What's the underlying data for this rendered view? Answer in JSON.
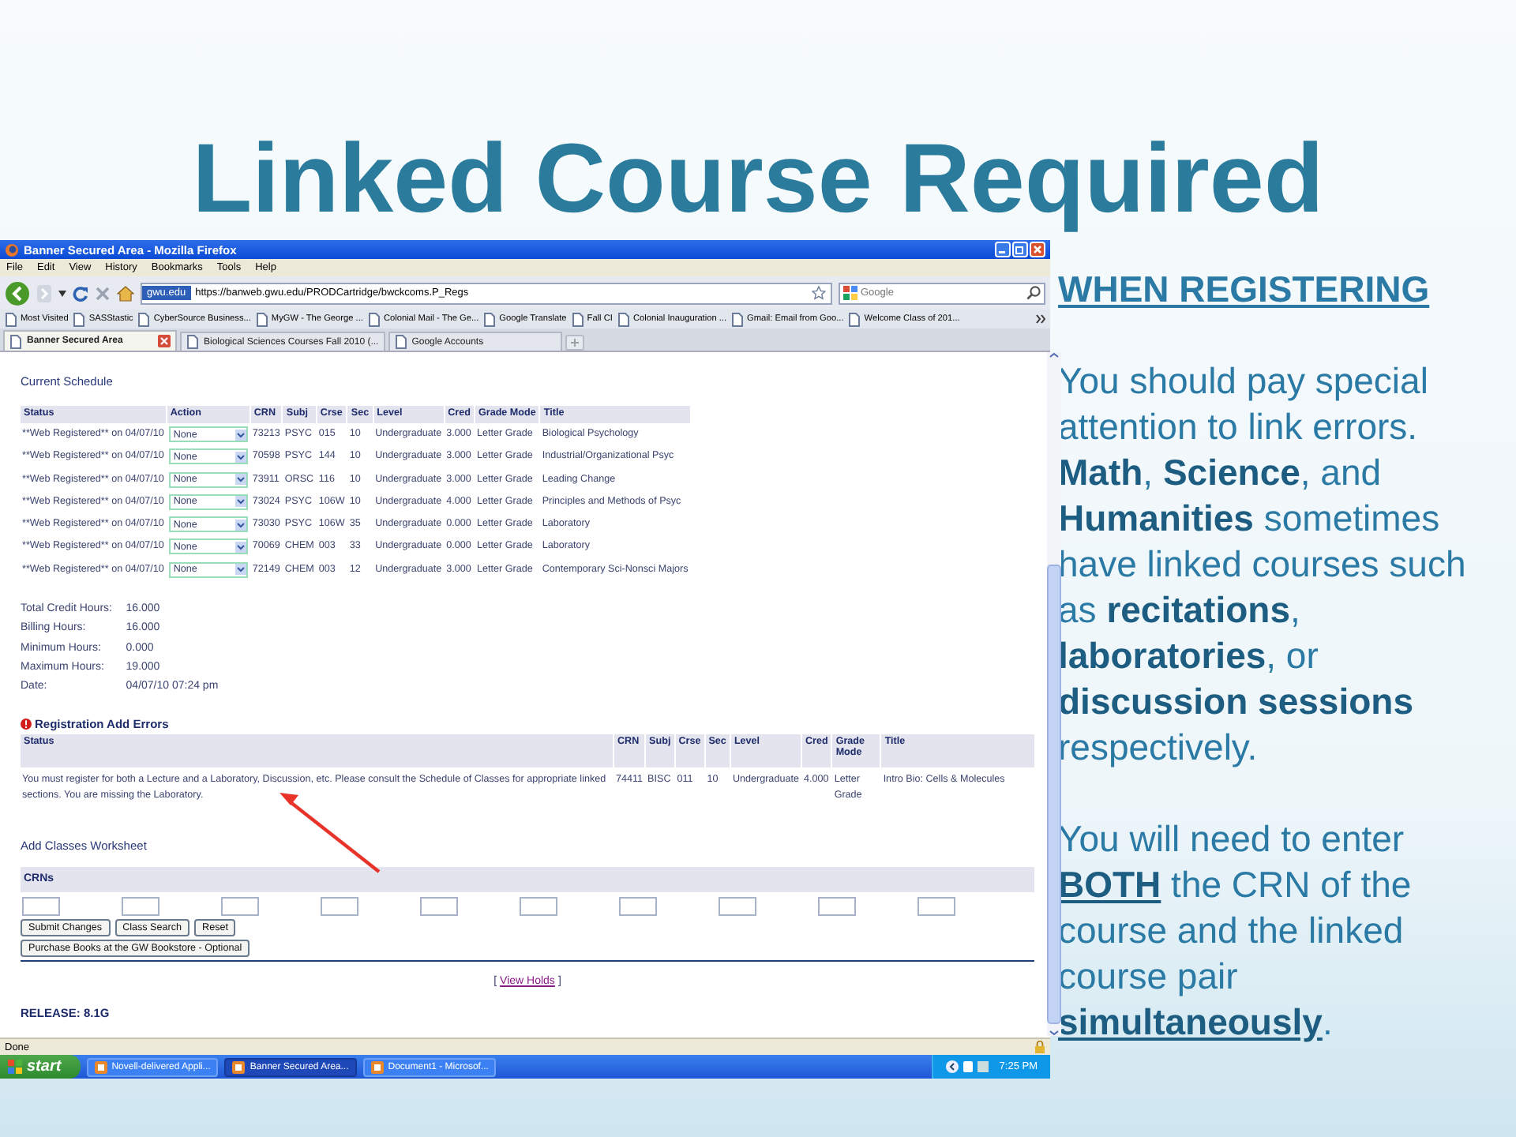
{
  "slide": {
    "title": "Linked Course Required"
  },
  "browser": {
    "window_title": "Banner Secured Area - Mozilla Firefox",
    "menu": [
      "File",
      "Edit",
      "View",
      "History",
      "Bookmarks",
      "Tools",
      "Help"
    ],
    "site_badge": "gwu.edu",
    "url": "https://banweb.gwu.edu/PRODCartridge/bwckcoms.P_Regs",
    "search_placeholder": "Google",
    "bookmarks": [
      "Most Visited",
      "SASStastic",
      "CyberSource Business...",
      "MyGW - The George ...",
      "Colonial Mail - The Ge...",
      "Google Translate",
      "Fall CI",
      "Colonial Inauguration ...",
      "Gmail: Email from Goo...",
      "Welcome Class of 201..."
    ],
    "tabs": [
      {
        "label": "Banner Secured Area",
        "selected": true
      },
      {
        "label": "Biological Sciences Courses Fall 2010 (...",
        "selected": false
      },
      {
        "label": "Google Accounts",
        "selected": false
      }
    ],
    "status_bar": "Done"
  },
  "page": {
    "schedule_heading": "Current Schedule",
    "schedule": {
      "columns": [
        "Status",
        "Action",
        "CRN",
        "Subj",
        "Crse",
        "Sec",
        "Level",
        "Cred",
        "Grade Mode",
        "Title"
      ],
      "rows": [
        [
          "**Web Registered** on 04/07/10",
          "None",
          "73213",
          "PSYC",
          "015",
          "10",
          "Undergraduate",
          "3.000",
          "Letter Grade",
          "Biological Psychology"
        ],
        [
          "**Web Registered** on 04/07/10",
          "None",
          "70598",
          "PSYC",
          "144",
          "10",
          "Undergraduate",
          "3.000",
          "Letter Grade",
          "Industrial/Organizational Psyc"
        ],
        [
          "**Web Registered** on 04/07/10",
          "None",
          "73911",
          "ORSC",
          "116",
          "10",
          "Undergraduate",
          "3.000",
          "Letter Grade",
          "Leading Change"
        ],
        [
          "**Web Registered** on 04/07/10",
          "None",
          "73024",
          "PSYC",
          "106W",
          "10",
          "Undergraduate",
          "4.000",
          "Letter Grade",
          "Principles and Methods of Psyc"
        ],
        [
          "**Web Registered** on 04/07/10",
          "None",
          "73030",
          "PSYC",
          "106W",
          "35",
          "Undergraduate",
          "0.000",
          "Letter Grade",
          "Laboratory"
        ],
        [
          "**Web Registered** on 04/07/10",
          "None",
          "70069",
          "CHEM",
          "003",
          "33",
          "Undergraduate",
          "0.000",
          "Letter Grade",
          "Laboratory"
        ],
        [
          "**Web Registered** on 04/07/10",
          "None",
          "72149",
          "CHEM",
          "003",
          "12",
          "Undergraduate",
          "3.000",
          "Letter Grade",
          "Contemporary Sci-Nonsci Majors"
        ]
      ]
    },
    "summary": [
      {
        "label": "Total Credit Hours:",
        "value": "16.000"
      },
      {
        "label": "Billing Hours:",
        "value": "16.000"
      },
      {
        "label": "Minimum Hours:",
        "value": "0.000"
      },
      {
        "label": "Maximum Hours:",
        "value": "19.000"
      },
      {
        "label": "Date:",
        "value": "04/07/10 07:24 pm"
      }
    ],
    "errors_heading": "Registration Add Errors",
    "errors": {
      "columns": [
        "Status",
        "CRN",
        "Subj",
        "Crse",
        "Sec",
        "Level",
        "Cred",
        "Grade Mode",
        "Title"
      ],
      "rows": [
        [
          "You must register for both a Lecture and a Laboratory, Discussion, etc. Please consult the Schedule of Classes for appropriate linked sections. You are missing the Laboratory.",
          "74411",
          "BISC",
          "011",
          "10",
          "Undergraduate",
          "4.000",
          "Letter Grade",
          "Intro Bio: Cells & Molecules"
        ]
      ]
    },
    "worksheet_heading": "Add Classes Worksheet",
    "crn_header": "CRNs",
    "crn_fields": [
      {
        "kind": "input"
      },
      {
        "kind": "input"
      },
      {
        "kind": "input"
      },
      {
        "kind": "input"
      },
      {
        "kind": "input"
      },
      {
        "kind": "input"
      },
      {
        "kind": "input"
      },
      {
        "kind": "input"
      },
      {
        "kind": "input"
      },
      {
        "kind": "input"
      }
    ],
    "button_rows": [
      [
        "Submit Changes",
        "Class Search",
        "Reset"
      ],
      [
        "Purchase Books at the GW Bookstore - Optional"
      ]
    ],
    "holds_link": {
      "before": "[",
      "label": "View Holds",
      "after": "]"
    },
    "release": "RELEASE: 8.1G"
  },
  "taskbar": {
    "start": "start",
    "tasks": [
      {
        "label": "Novell-delivered Appli...",
        "selected": false
      },
      {
        "label": "Banner Secured Area...",
        "selected": true
      },
      {
        "label": "Document1 - Microsof...",
        "selected": false
      }
    ],
    "clock": "7:25 PM"
  },
  "notes": {
    "heading": "WHEN REGISTERING",
    "paragraphs": [
      {
        "text": "You should pay special attention to link errors. **Math**, **Science**, and **Humanities** sometimes have linked courses such as **recitations**, **laboratories**, or **discussion sessions** respectively.",
        "bold_underlined": false
      },
      {
        "text": "You will need to enter **BOTH** the CRN of the course and the linked course pair **simultaneously**.",
        "bold_underlined": true
      }
    ]
  }
}
